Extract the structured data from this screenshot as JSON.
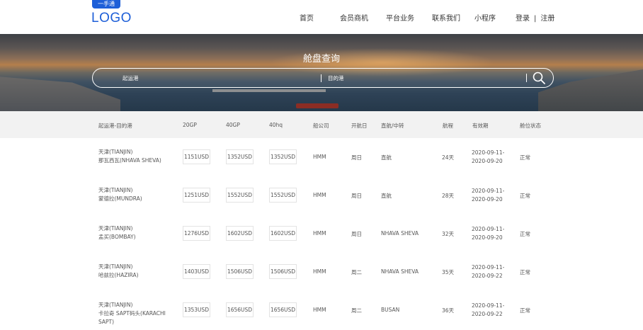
{
  "header": {
    "logo_badge": "一手通",
    "logo": "LOGO",
    "nav": [
      "首页",
      "会员商机",
      "平台业务",
      "联系我们",
      "小程序"
    ],
    "login": "登录",
    "separator": "|",
    "register": "注册"
  },
  "hero": {
    "title": "舱盘查询",
    "from_placeholder": "起运港",
    "to_placeholder": "目的港",
    "search_icon": "search-icon"
  },
  "table": {
    "headers": [
      "起运港-目的港",
      "20GP",
      "40GP",
      "40hq",
      "船公司",
      "开航日",
      "直航/中转",
      "航程",
      "有效期",
      "舱位状态"
    ],
    "rows": [
      {
        "origin": "天津(TIANJIN)",
        "dest": "那瓦西瓦(NHAVA SHEVA)",
        "gp20": "1151USD",
        "gp40": "1352USD",
        "hq40": "1352USD",
        "carrier": "HMM",
        "sail": "周日",
        "route": "直航",
        "days": "24天",
        "valid_from": "2020-09-11-",
        "valid_to": "2020-09-20",
        "status": "正常"
      },
      {
        "origin": "天津(TIANJIN)",
        "dest": "蒙德拉(MUNDRA)",
        "gp20": "1251USD",
        "gp40": "1552USD",
        "hq40": "1552USD",
        "carrier": "HMM",
        "sail": "周日",
        "route": "直航",
        "days": "28天",
        "valid_from": "2020-09-11-",
        "valid_to": "2020-09-20",
        "status": "正常"
      },
      {
        "origin": "天津(TIANJIN)",
        "dest": "孟买(BOMBAY)",
        "gp20": "1276USD",
        "gp40": "1602USD",
        "hq40": "1602USD",
        "carrier": "HMM",
        "sail": "周日",
        "route": "NHAVA SHEVA",
        "days": "32天",
        "valid_from": "2020-09-11-",
        "valid_to": "2020-09-20",
        "status": "正常"
      },
      {
        "origin": "天津(TIANJIN)",
        "dest": "哈兹拉(HAZIRA)",
        "gp20": "1403USD",
        "gp40": "1506USD",
        "hq40": "1506USD",
        "carrier": "HMM",
        "sail": "周二",
        "route": "NHAVA SHEVA",
        "days": "35天",
        "valid_from": "2020-09-11-",
        "valid_to": "2020-09-22",
        "status": "正常"
      },
      {
        "origin": "天津(TIANJIN)",
        "dest": "卡拉奇 SAPT码头(KARACHI SAPT)",
        "gp20": "1353USD",
        "gp40": "1656USD",
        "hq40": "1656USD",
        "carrier": "HMM",
        "sail": "周二",
        "route": "BUSAN",
        "days": "36天",
        "valid_from": "2020-09-11-",
        "valid_to": "2020-09-22",
        "status": "正常"
      }
    ]
  },
  "colors": {
    "brand": "#1e5fd8",
    "header_bg": "#f2f2f2"
  }
}
